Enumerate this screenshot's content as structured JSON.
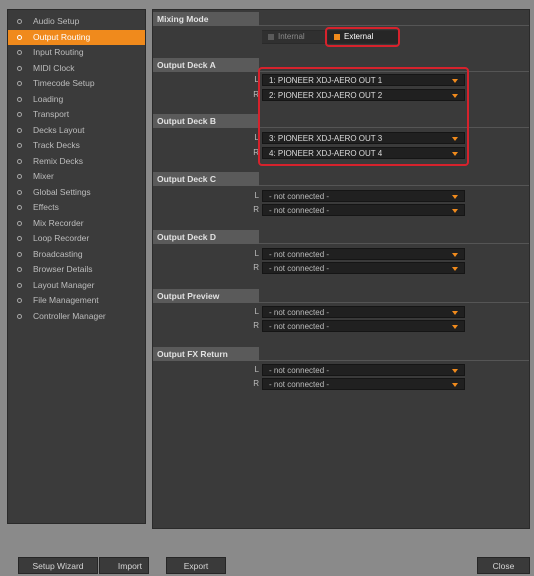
{
  "sidebar": {
    "items": [
      {
        "label": "Audio Setup",
        "active": false
      },
      {
        "label": "Output Routing",
        "active": true
      },
      {
        "label": "Input Routing",
        "active": false
      },
      {
        "label": "MIDI Clock",
        "active": false
      },
      {
        "label": "Timecode Setup",
        "active": false
      },
      {
        "label": "Loading",
        "active": false
      },
      {
        "label": "Transport",
        "active": false
      },
      {
        "label": "Decks Layout",
        "active": false
      },
      {
        "label": "Track Decks",
        "active": false
      },
      {
        "label": "Remix Decks",
        "active": false
      },
      {
        "label": "Mixer",
        "active": false
      },
      {
        "label": "Global Settings",
        "active": false
      },
      {
        "label": "Effects",
        "active": false
      },
      {
        "label": "Mix Recorder",
        "active": false
      },
      {
        "label": "Loop Recorder",
        "active": false
      },
      {
        "label": "Broadcasting",
        "active": false
      },
      {
        "label": "Browser Details",
        "active": false
      },
      {
        "label": "Layout Manager",
        "active": false
      },
      {
        "label": "File Management",
        "active": false
      },
      {
        "label": "Controller Manager",
        "active": false
      }
    ]
  },
  "mixing_mode": {
    "title": "Mixing Mode",
    "internal_label": "Internal",
    "external_label": "External",
    "selected": "External"
  },
  "sections": {
    "deck_a": {
      "title": "Output Deck A",
      "l_label": "L",
      "r_label": "R",
      "l_value": "1: PIONEER XDJ-AERO OUT 1",
      "r_value": "2: PIONEER XDJ-AERO OUT 2"
    },
    "deck_b": {
      "title": "Output Deck B",
      "l_label": "L",
      "r_label": "R",
      "l_value": "3: PIONEER XDJ-AERO OUT 3",
      "r_value": "4: PIONEER XDJ-AERO OUT 4"
    },
    "deck_c": {
      "title": "Output Deck C",
      "l_label": "L",
      "r_label": "R",
      "l_value": "- not connected -",
      "r_value": "- not connected -"
    },
    "deck_d": {
      "title": "Output Deck D",
      "l_label": "L",
      "r_label": "R",
      "l_value": "- not connected -",
      "r_value": "- not connected -"
    },
    "preview": {
      "title": "Output Preview",
      "l_label": "L",
      "r_label": "R",
      "l_value": "- not connected -",
      "r_value": "- not connected -"
    },
    "fx_return": {
      "title": "Output FX Return",
      "l_label": "L",
      "r_label": "R",
      "l_value": "- not connected -",
      "r_value": "- not connected -"
    }
  },
  "footer": {
    "setup_wizard": "Setup Wizard",
    "import": "Import",
    "export": "Export",
    "close": "Close"
  },
  "colors": {
    "accent": "#f08a1c",
    "highlight": "#d6222c",
    "panel": "#3a3a3a"
  }
}
